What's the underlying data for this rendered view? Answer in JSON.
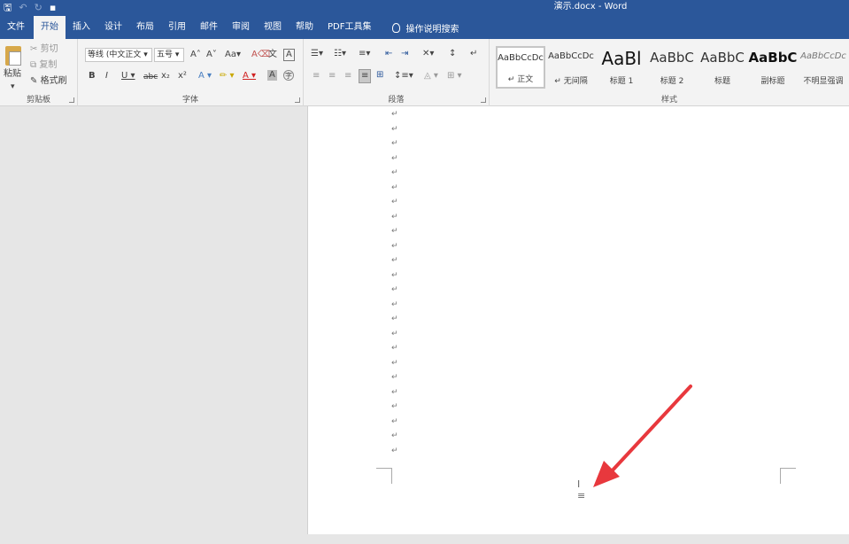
{
  "window": {
    "title": "演示.docx  -  Word"
  },
  "tabs": [
    "文件",
    "开始",
    "插入",
    "设计",
    "布局",
    "引用",
    "邮件",
    "审阅",
    "视图",
    "帮助",
    "PDF工具集"
  ],
  "active_tab": "开始",
  "tell_me": "操作说明搜索",
  "clipboard": {
    "label": "剪贴板",
    "paste": "粘贴",
    "cut": "剪切",
    "copy": "复制",
    "format_painter": "格式刷"
  },
  "font": {
    "label": "字体",
    "font_name": "等线 (中文正文",
    "font_size": "五号"
  },
  "paragraph": {
    "label": "段落"
  },
  "styles": {
    "label": "样式",
    "items": [
      {
        "sample": "AaBbCcDc",
        "name": "↵ 正文"
      },
      {
        "sample": "AaBbCcDc",
        "name": "↵ 无间隔"
      },
      {
        "sample": "AaBl",
        "name": "标题 1"
      },
      {
        "sample": "AaBbC",
        "name": "标题 2"
      },
      {
        "sample": "AaBbC",
        "name": "标题"
      },
      {
        "sample": "AaBbC",
        "name": "副标题"
      },
      {
        "sample": "AaBbCcDc",
        "name": "不明显强调"
      }
    ]
  },
  "document": {
    "paragraph_mark": "↵",
    "paragraph_count": 24
  },
  "colors": {
    "accent": "#2b579a",
    "arrow": "#e8383d"
  }
}
